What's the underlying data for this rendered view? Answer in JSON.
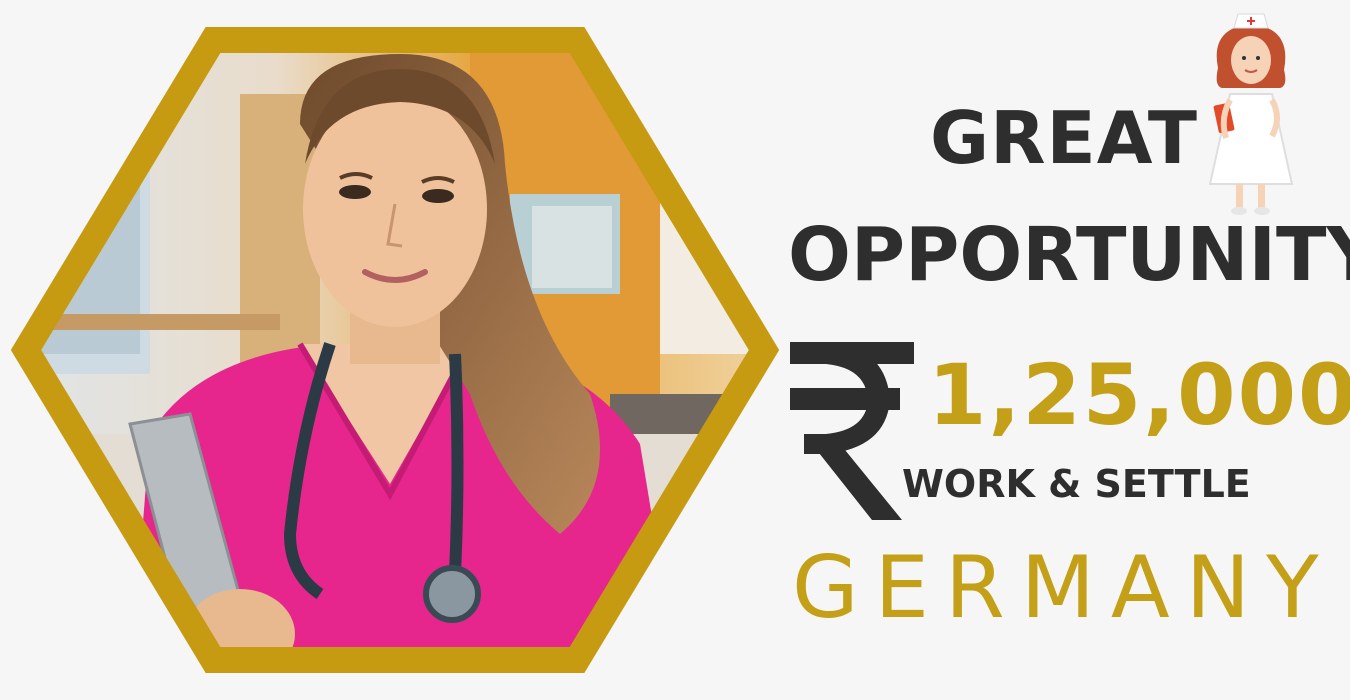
{
  "headline": {
    "line1": "GREAT",
    "line2": "OPPORTUNITY"
  },
  "salary": {
    "currency_symbol": "₹",
    "amount": "1,25,000"
  },
  "tagline": "WORK & SETTLE",
  "country": "GERMANY",
  "colors": {
    "background": "#f6f6f6",
    "gold": "#c4a019",
    "dark_text": "#2e2e2e",
    "scrubs_pink": "#e6268c"
  },
  "images": {
    "hero_photo": "nurse-in-pink-scrubs-with-stethoscope",
    "cartoon": "cartoon-nurse-icon"
  }
}
